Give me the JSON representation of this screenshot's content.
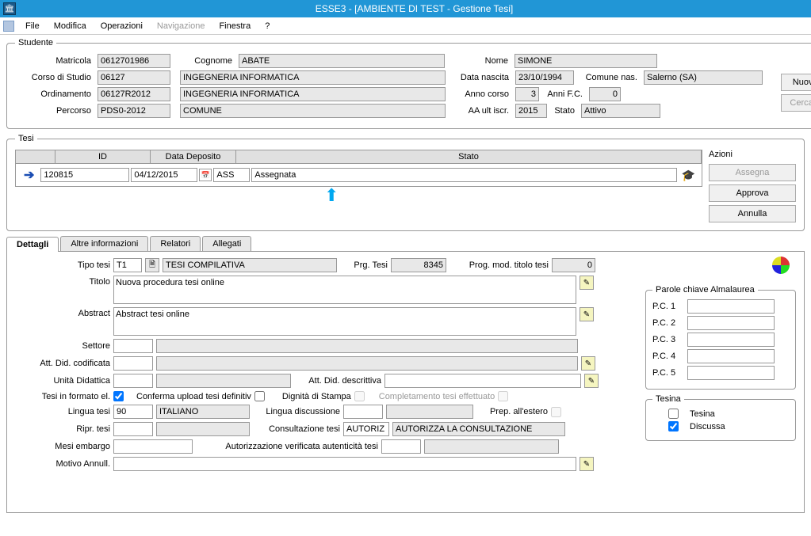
{
  "window": {
    "title": "ESSE3 - [AMBIENTE DI TEST - Gestione Tesi]"
  },
  "menu": {
    "file": "File",
    "modifica": "Modifica",
    "operazioni": "Operazioni",
    "navigazione": "Navigazione",
    "finestra": "Finestra",
    "help": "?"
  },
  "studente": {
    "legend": "Studente",
    "matricola_lbl": "Matricola",
    "matricola": "0612701986",
    "cognome_lbl": "Cognome",
    "cognome": "ABATE",
    "nome_lbl": "Nome",
    "nome": "SIMONE",
    "corso_lbl": "Corso di Studio",
    "corso_cod": "06127",
    "corso_des": "INGEGNERIA INFORMATICA",
    "data_nascita_lbl": "Data nascita",
    "data_nascita": "23/10/1994",
    "comune_lbl": "Comune  nas.",
    "comune": "Salerno (SA)",
    "ord_lbl": "Ordinamento",
    "ord_cod": "06127R2012",
    "ord_des": "INGEGNERIA INFORMATICA",
    "anno_corso_lbl": "Anno corso",
    "anno_corso": "3",
    "anni_fc_lbl": "Anni F.C.",
    "anni_fc": "0",
    "percorso_lbl": "Percorso",
    "percorso_cod": "PDS0-2012",
    "percorso_des": "COMUNE",
    "aa_lbl": "AA ult iscr.",
    "aa": "2015",
    "stato_lbl": "Stato",
    "stato": "Attivo",
    "btn_nuova": "Nuova ricerca",
    "btn_cerca": "Cerca studente"
  },
  "tesi": {
    "legend": "Tesi",
    "col_id": "ID",
    "col_data": "Data Deposito",
    "col_stato": "Stato",
    "row": {
      "id": "120815",
      "data": "04/12/2015",
      "stato_cod": "ASS",
      "stato_des": "Assegnata"
    },
    "azioni_lbl": "Azioni",
    "btn_assegna": "Assegna",
    "btn_approva": "Approva",
    "btn_annulla": "Annulla"
  },
  "tabs": {
    "dettagli": "Dettagli",
    "altre": "Altre informazioni",
    "relatori": "Relatori",
    "allegati": "Allegati"
  },
  "det": {
    "tipo_lbl": "Tipo tesi",
    "tipo_cod": "T1",
    "tipo_des": "TESI COMPILATIVA",
    "prg_lbl": "Prg. Tesi",
    "prg": "8345",
    "prog_mod_lbl": "Prog. mod. titolo tesi",
    "prog_mod": "0",
    "titolo_lbl": "Titolo",
    "titolo": "Nuova procedura tesi online",
    "abstract_lbl": "Abstract",
    "abstract": "Abstract tesi online",
    "settore_lbl": "Settore",
    "settore": "",
    "attcod_lbl": "Att. Did. codificata",
    "attcod": "",
    "unita_lbl": "Unità Didattica",
    "unita": "",
    "attdesc_lbl": "Att. Did. descrittiva",
    "attdesc": "",
    "formato_lbl": "Tesi in formato el.",
    "conferma_lbl": "Conferma upload tesi definitiv",
    "dignita_lbl": "Dignità di Stampa",
    "completamento_lbl": "Completamento tesi effettuato",
    "lingua_lbl": "Lingua tesi",
    "lingua_cod": "90",
    "lingua_des": "ITALIANO",
    "lingua_disc_lbl": "Lingua discussione",
    "prep_estero_lbl": "Prep. all'estero",
    "ripr_lbl": "Ripr. tesi",
    "cons_lbl": "Consultazione tesi",
    "cons_cod": "AUTORIZ",
    "cons_des": "AUTORIZZA LA CONSULTAZIONE",
    "mesi_lbl": "Mesi embargo",
    "autver_lbl": "Autorizzazione verificata autenticità tesi",
    "motivo_lbl": "Motivo Annull."
  },
  "pc": {
    "legend": "Parole chiave Almalaurea",
    "p1": "P.C. 1",
    "p2": "P.C. 2",
    "p3": "P.C. 3",
    "p4": "P.C. 4",
    "p5": "P.C. 5"
  },
  "tesina": {
    "legend": "Tesina",
    "tesina": "Tesina",
    "discussa": "Discussa"
  }
}
